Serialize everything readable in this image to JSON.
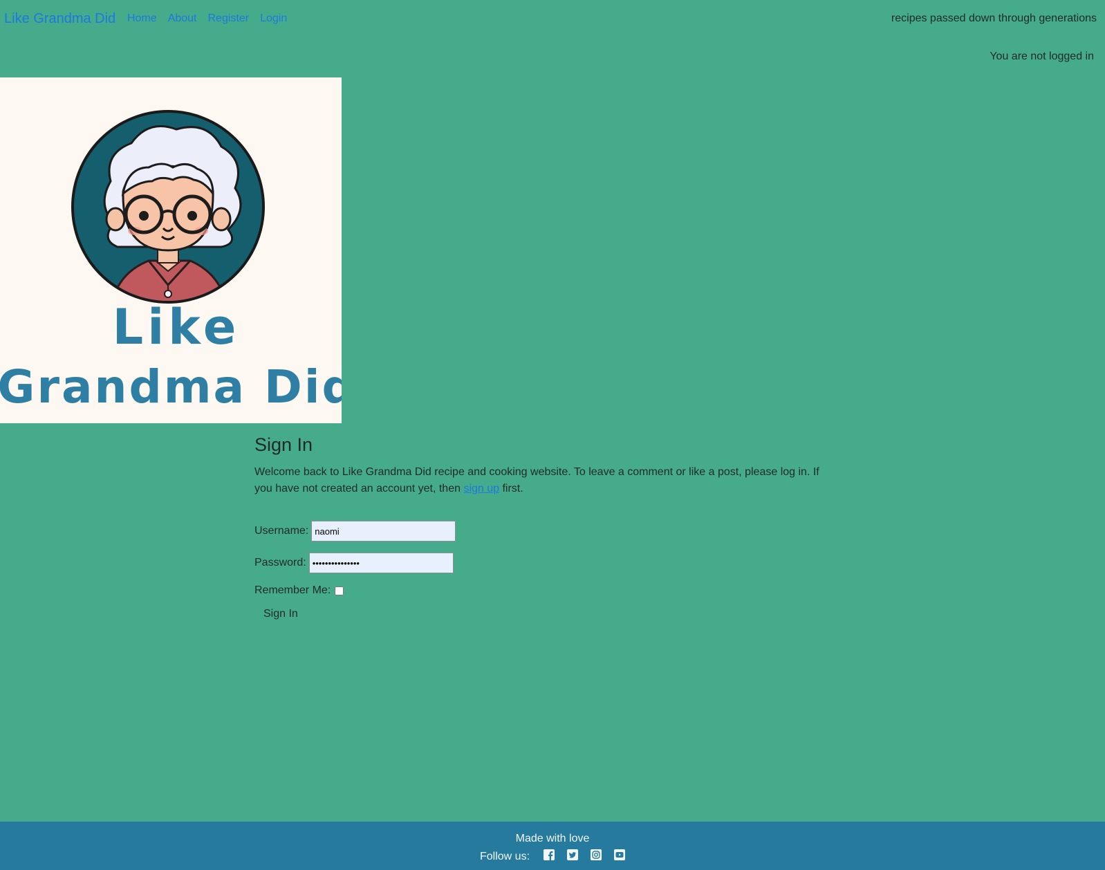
{
  "nav": {
    "brand": "Like Grandma Did",
    "links": [
      "Home",
      "About",
      "Register",
      "Login"
    ],
    "tagline": "recipes passed down through generations",
    "status": "You are not logged in"
  },
  "hero": {
    "logo_text_line1": "Like",
    "logo_text_line2": "Grandma Did"
  },
  "main": {
    "title": "Sign In",
    "intro_before": "Welcome back to Like Grandma Did recipe and cooking website. To leave a comment or like a post, please log in. If you have not created an account yet, then ",
    "intro_link": "sign up",
    "intro_after": " first.",
    "form": {
      "username_label": "Username:",
      "username_value": "naomi",
      "password_label": "Password:",
      "password_value": "•••••••••••••••",
      "remember_label": "Remember Me:",
      "remember_checked": false,
      "submit_label": "Sign In"
    }
  },
  "footer": {
    "made_with": "Made with love",
    "follow_label": "Follow us:",
    "social_icons": [
      "facebook-icon",
      "twitter-icon",
      "instagram-icon",
      "youtube-icon"
    ]
  },
  "colors": {
    "page_bg": "#45ab8b",
    "footer_bg": "#267a9e",
    "link": "#1f78e0",
    "hero_bg": "#fdf8f1",
    "logo_text": "#2e7fa3",
    "logo_circle": "#155e6e"
  }
}
